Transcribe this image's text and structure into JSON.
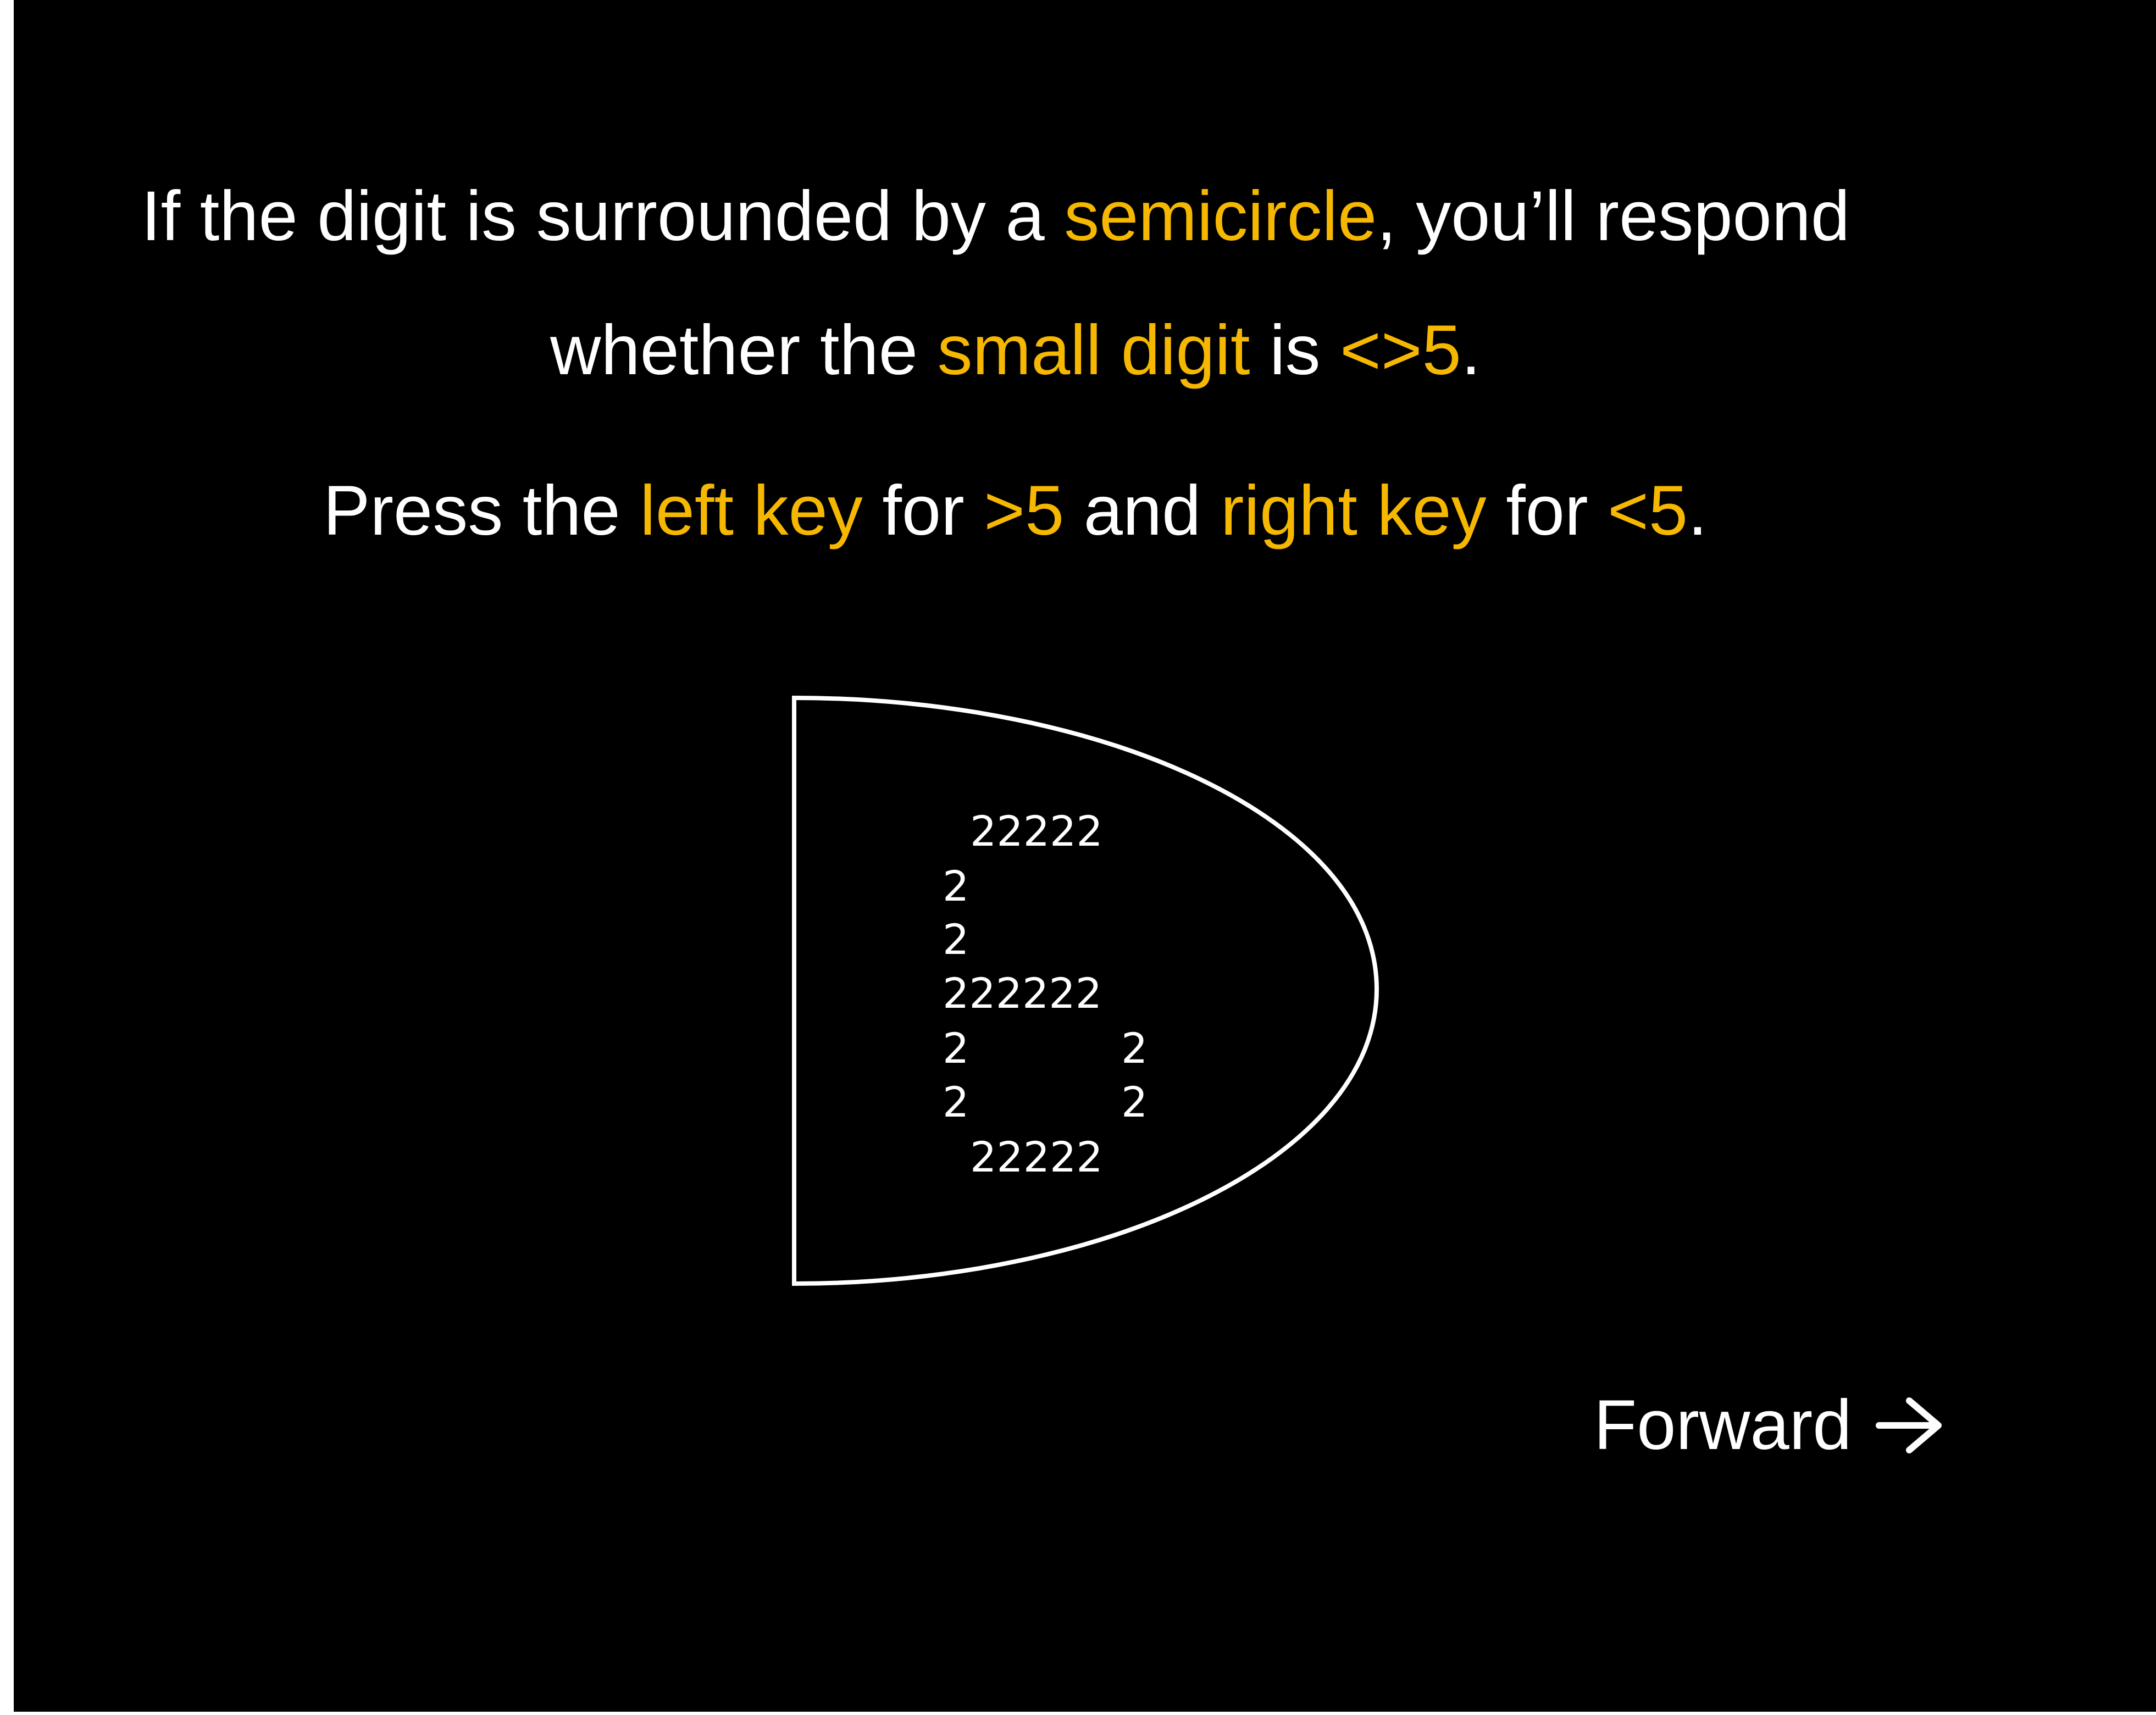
{
  "colors": {
    "background": "#000000",
    "text": "#ffffff",
    "highlight": "#F5B700"
  },
  "instructions": {
    "line1": {
      "a": "If the digit is surrounded by a ",
      "b": "semicircle",
      "c": ", you’ll respond"
    },
    "line2": {
      "a": "whether the ",
      "b": "small digit",
      "c": " is ",
      "d": "<>5",
      "e": "."
    },
    "line3": {
      "a": "Press the ",
      "b": "left key",
      "c": " for ",
      "d": ">5",
      "e": " and ",
      "f": "right key",
      "g": " for ",
      "h": "<5",
      "i": "."
    }
  },
  "stimulus": {
    "shape": "semicircle",
    "digit_rows": [
      "22222",
      "2",
      "2",
      "222222",
      "2",
      "2",
      "2",
      "2",
      "22222"
    ]
  },
  "navigation": {
    "forward_label": "Forward",
    "forward_icon": "arrow-right-icon"
  }
}
